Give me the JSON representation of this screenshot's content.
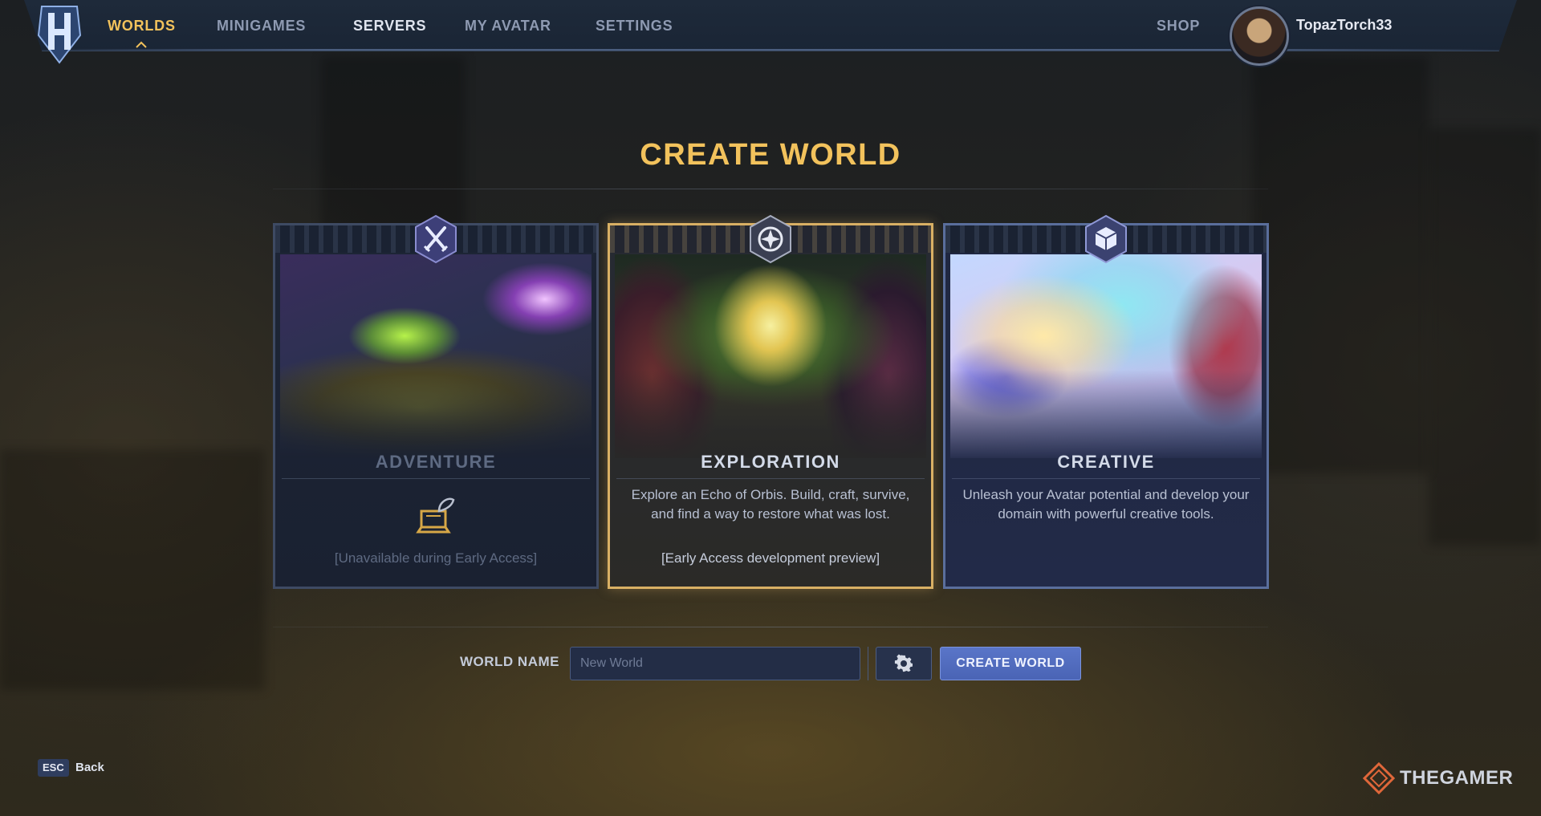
{
  "nav": {
    "items": [
      {
        "label": "WORLDS",
        "active": true
      },
      {
        "label": "MINIGAMES"
      },
      {
        "label": "SERVERS"
      },
      {
        "label": "MY AVATAR"
      },
      {
        "label": "SETTINGS"
      }
    ],
    "shop_label": "SHOP",
    "username": "TopazTorch33",
    "logo_letter": "H"
  },
  "page": {
    "title": "CREATE WORLD"
  },
  "cards": [
    {
      "title": "ADVENTURE",
      "icon": "crossed-swords-icon",
      "description": "",
      "note": "[Unavailable during Early Access]",
      "available": false
    },
    {
      "title": "EXPLORATION",
      "icon": "compass-icon",
      "description": "Explore an Echo of Orbis. Build, craft, survive, and find a way to restore what was lost.",
      "note": "[Early Access development preview]",
      "selected": true
    },
    {
      "title": "CREATIVE",
      "icon": "cube-icon",
      "description": "Unleash your Avatar potential and develop your domain with powerful creative tools.",
      "note": ""
    }
  ],
  "form": {
    "label": "WORLD NAME",
    "placeholder": "New World",
    "value": "",
    "create_label": "CREATE WORLD"
  },
  "footer": {
    "esc_key": "ESC",
    "back_label": "Back",
    "watermark": "THEGAMER"
  },
  "colors": {
    "accent_gold": "#f2c25c",
    "button_blue": "#5a75c8",
    "nav_bg": "#1e2a3a"
  }
}
